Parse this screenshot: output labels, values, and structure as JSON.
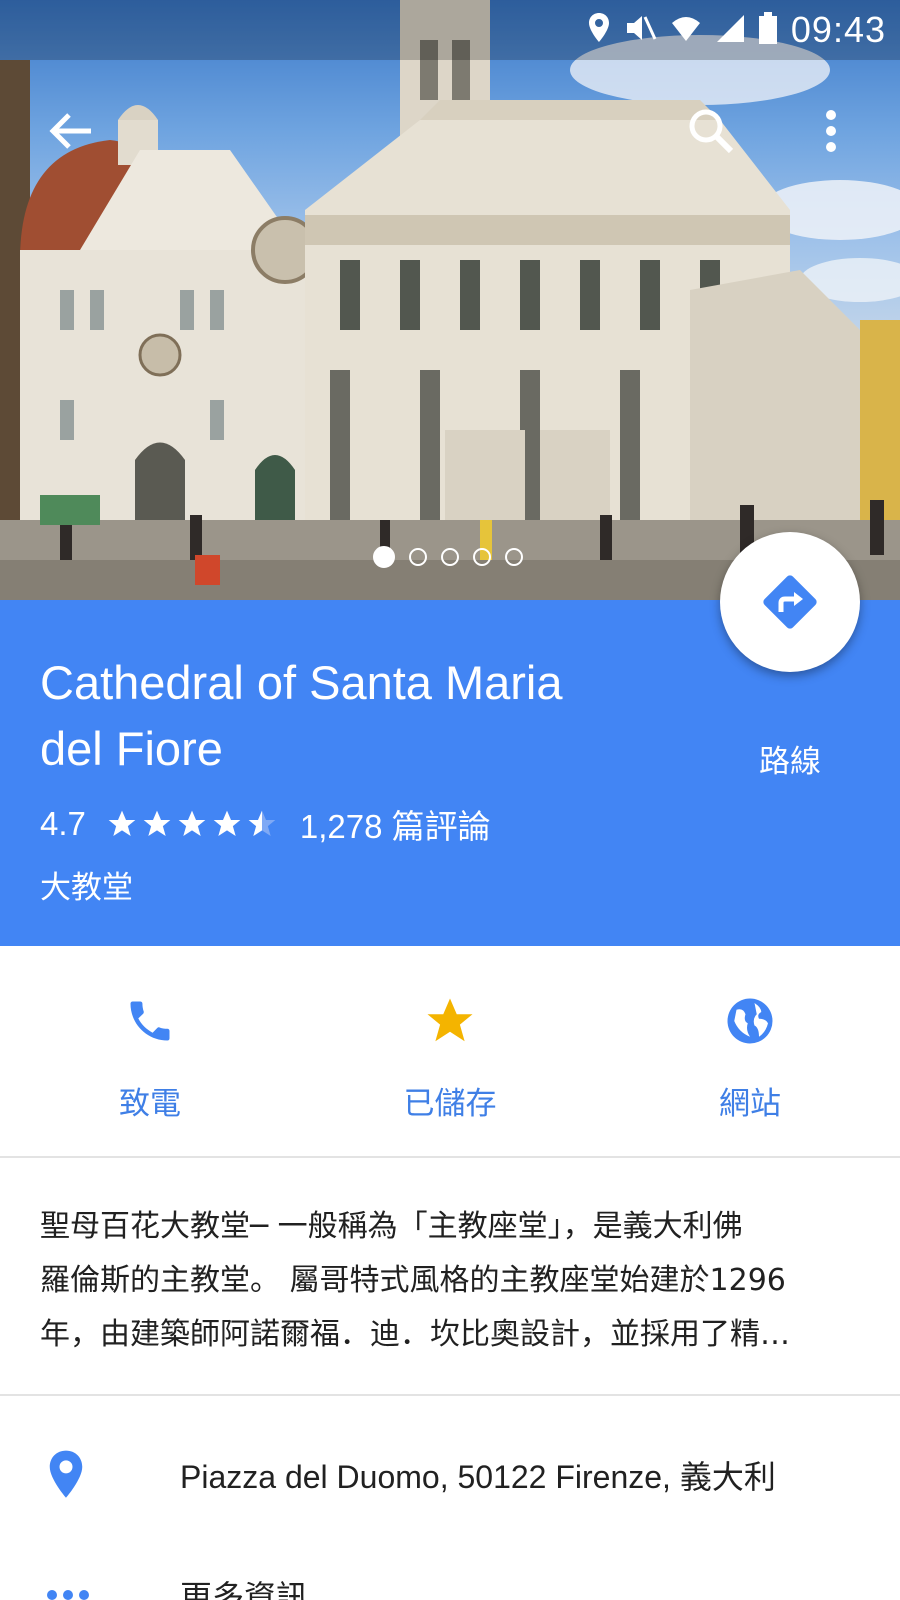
{
  "status_bar": {
    "time": "09:43",
    "icons": [
      "location-icon",
      "mute-icon",
      "wifi-icon",
      "signal-icon",
      "battery-icon"
    ]
  },
  "toolbar": {
    "back_icon": "arrow-left",
    "search_icon": "search",
    "more_icon": "more-vertical"
  },
  "gallery": {
    "photo_count": 5,
    "active_index": 0
  },
  "place": {
    "title_line1": "Cathedral of Santa Maria",
    "title_line2": "del Fiore",
    "rating": "4.7",
    "stars": 4.5,
    "reviews": "1,278 篇評論",
    "category": "大教堂",
    "directions_label": "路線",
    "panel_color": "#4285f4"
  },
  "actions": [
    {
      "label": "致電",
      "icon": "phone-icon"
    },
    {
      "label": "已儲存",
      "icon": "star-icon"
    },
    {
      "label": "網站",
      "icon": "globe-icon"
    }
  ],
  "description": {
    "line1": "聖母百花大教堂─ 一般稱為「主教座堂」，是義大利佛",
    "line2": "羅倫斯的主教堂。 屬哥特式風格的主教座堂始建於1296",
    "line3": "年，由建築師阿諾爾福．迪．坎比奧設計，並採用了精…"
  },
  "details": {
    "address": "Piazza del Duomo, 50122 Firenze, 義大利",
    "more_info": "更多資訊"
  },
  "colors": {
    "accent": "#4285f4",
    "action_text": "#3f7fe6",
    "saved_star": "#f4b400"
  }
}
